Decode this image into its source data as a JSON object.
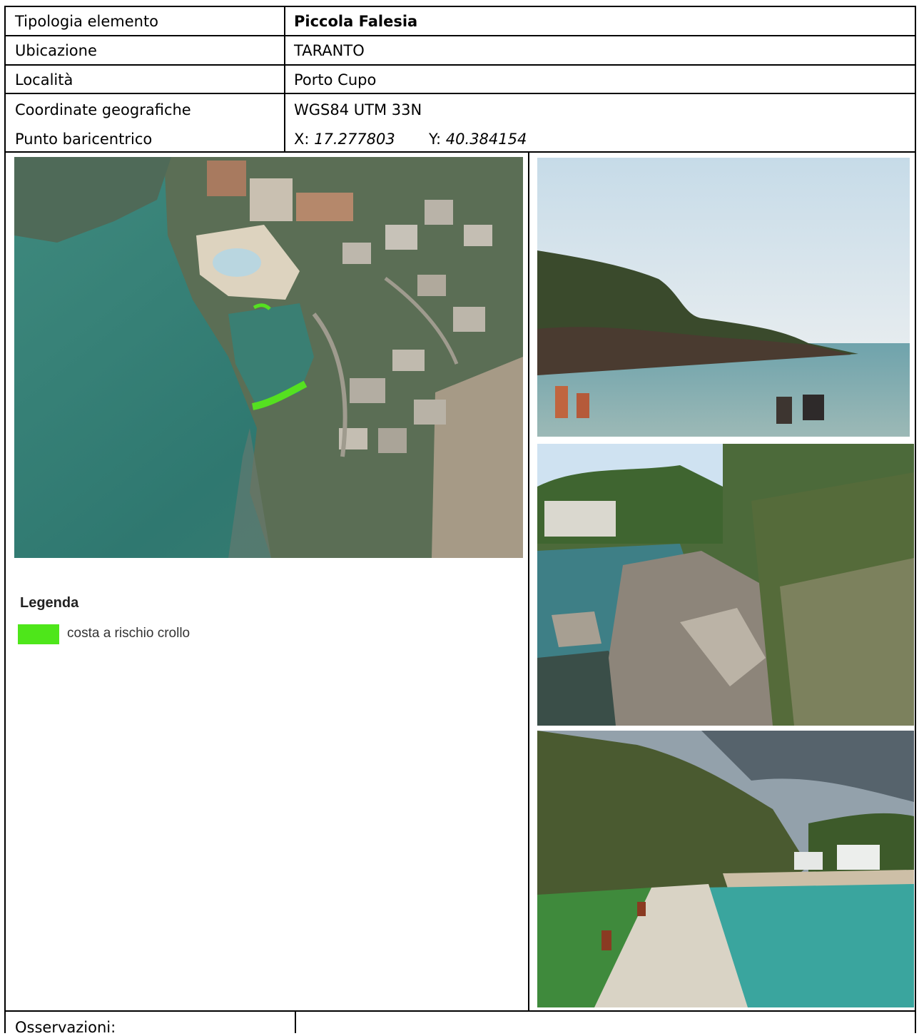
{
  "rows": [
    {
      "label": "Tipologia elemento",
      "value": "Piccola Falesia"
    },
    {
      "label": "Ubicazione",
      "value": "TARANTO"
    },
    {
      "label": "Località",
      "value": "Porto Cupo"
    },
    {
      "label": "Coordinate geografiche",
      "value": "WGS84 UTM 33N"
    }
  ],
  "barycenter": {
    "label": "Punto baricentrico",
    "x_prefix": "X: ",
    "x_value": "17.277803",
    "y_prefix": "Y: ",
    "y_value": "40.384154"
  },
  "legend": {
    "title": "Legenda",
    "item_label": "costa a rischio crollo",
    "item_color": "#4ee61a"
  },
  "observations": {
    "label": "Osservazioni:"
  }
}
